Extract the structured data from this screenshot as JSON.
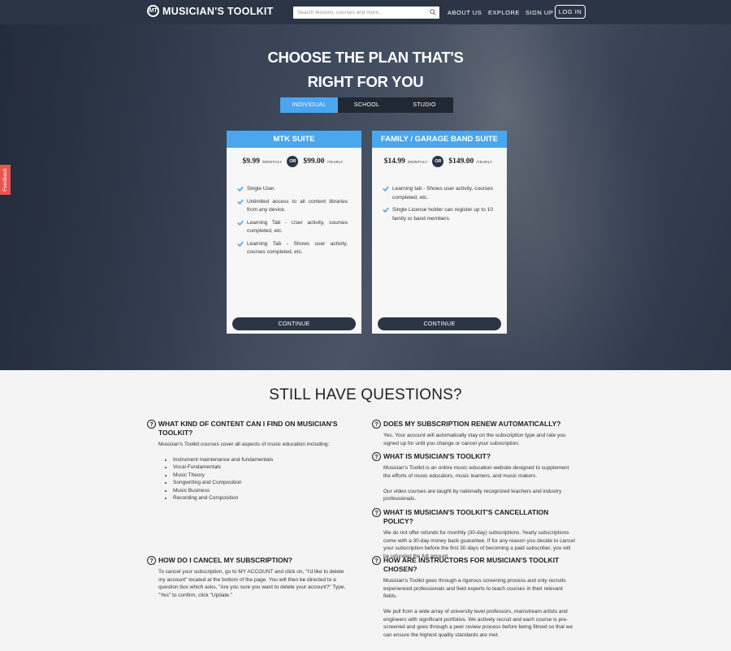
{
  "nav": {
    "logo_mark": "MT",
    "logo_text": "MUSICIAN'S TOOLKIT",
    "search_placeholder": "Search lessons, courses and more...",
    "links": [
      "ABOUT US",
      "EXPLORE",
      "SIGN UP"
    ],
    "login": "LOG IN"
  },
  "hero": {
    "title_line1": "CHOOSE THE PLAN THAT'S",
    "title_line2": "RIGHT FOR YOU",
    "tabs": [
      "INDIVIDUAL",
      "SCHOOL",
      "STUDIO"
    ],
    "active_tab": "INDIVIDUAL"
  },
  "plans": [
    {
      "name": "MTK SUITE",
      "monthly_price": "$9.99",
      "monthly_label": "/MONTHLY",
      "or": "OR",
      "yearly_price": "$99.00",
      "yearly_label": "/YEARLY",
      "features": [
        "Single User.",
        "Unlimited access to all content libraries from any device.",
        "Learning Tab - User activity, courses completed, etc.",
        "Learning Tab - Shows user activity, courses completed, etc."
      ],
      "cta": "CONTINUE"
    },
    {
      "name": "FAMILY / GARAGE BAND SUITE",
      "monthly_price": "$14.99",
      "monthly_label": "/MONTHLY",
      "or": "OR",
      "yearly_price": "$149.00",
      "yearly_label": "/YEARLY",
      "features": [
        "Learning tab - Shows user activity, courses completed, etc.",
        "Single License holder can register up to 10 family or band members."
      ],
      "cta": "CONTINUE"
    }
  ],
  "feedback": "Feedback",
  "faq": {
    "title": "STILL HAVE QUESTIONS?",
    "items": [
      {
        "q": "WHAT KIND OF CONTENT CAN I FIND ON MUSICIAN'S TOOLKIT?",
        "a": [
          "Musician's Toolkit courses cover all aspects of music education including:"
        ],
        "list": [
          "Instrument maintenance and fundamentals",
          "Vocal Fundamentals",
          "Music Theory",
          "Songwriting and Composition",
          "Music Business",
          "Recording and Composition"
        ]
      },
      {
        "q": "HOW DO I CANCEL MY SUBSCRIPTION?",
        "a": [
          "To cancel your subscription, go to MY ACCOUNT and click on, \"I'd like to delete my account\" located at the bottom of the page. You will then be directed to a question box which asks, \"Are you sure you want to delete your account?\" Type, \"Yes\" to confirm, click \"Update.\""
        ]
      },
      {
        "q": "DOES MY SUBSCRIPTION RENEW AUTOMATICALLY?",
        "a": [
          "Yes. Your account will automatically stay on the subscription type and rate you signed up for until you change or cancel your subscription."
        ]
      },
      {
        "q": "WHAT IS MUSICIAN'S TOOLKIT?",
        "a": [
          "Musician's Toolkit is an online music education website designed to supplement the efforts of music educators, music learners, and music makers.",
          "Our video courses are taught by nationally recognized teachers and industry professionals."
        ]
      },
      {
        "q": "WHAT IS MUSICIAN'S TOOLKIT'S CANCELLATION POLICY?",
        "a": [
          "We do not offer refunds for monthly (30-day) subscriptions. Yearly subscriptions come with a 30-day money back guarantee. If for any reason you decide to cancel your subscription before the first 30 days of becoming a paid subscriber, you will be refunded the full amount."
        ]
      },
      {
        "q": "HOW ARE INSTRUCTORS FOR MUSICIAN'S TOOLKIT CHOSEN?",
        "a": [
          "Musician's Toolkit goes through a rigorous screening process and only recruits experienced professionals and field experts to teach courses in their relevant fields.",
          "We pull from a wide array of university level professors, mainstream artists and engineers with significant portfolios. We actively recruit and each course is pre-screened and goes through a peer review process before being filmed so that we can ensure the highest quality standards are met."
        ]
      }
    ]
  },
  "colors": {
    "accent": "#4aa6ee",
    "dark": "#2b3546",
    "feedback": "#e8554e"
  }
}
